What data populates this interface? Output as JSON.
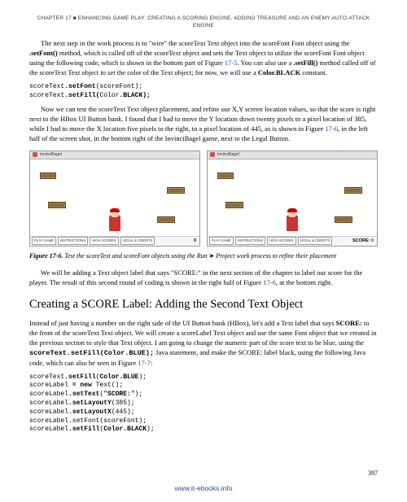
{
  "header": "CHAPTER 17 ■ ENHANCING GAME PLAY: CREATING A SCORING ENGINE, ADDING TREASURE AND AN ENEMY AUTO-ATTACK ENGINE",
  "para1_a": "The next step in the work process is to \"wire\" the scoreText Text object into the scoreFont Font object using the ",
  "para1_b": ".setFont()",
  "para1_c": " method, which is called off of the scoreText object and sets the Text object to utilize the scoreFont Font object using the following code, which is shown in the bottom part of Figure ",
  "para1_d": "17-5",
  "para1_e": ". You can also use a ",
  "para1_f": ".setFill()",
  "para1_g": " method called off of the scoreText Text object to set the color of the Text object; for now, we will use a ",
  "para1_h": "Color.BLACK",
  "para1_i": " constant.",
  "code1_l1": "scoreText",
  "code1_l1b": ".setFont",
  "code1_l1c": "(scoreFont);",
  "code1_l2": "scoreText",
  "code1_l2b": ".setFill(",
  "code1_l2c": "Color",
  "code1_l2d": ".BLACK);",
  "para2_a": "Now we can test the scoreText Text object placement, and refine our X,Y screen location values, so that the score is right next to the HBox UI Button bank. I found that I had to move the Y location down twenty pixels to a pixel location of 385, while I had to move the X location five pixels to the right, to a pixel location of 445, as is shown in Figure ",
  "para2_b": "17-6",
  "para2_c": ", in the left half of the screen shot, in the bottom right of the InvinciBagel game, next to the Legal Button.",
  "fig_title": "InvinciBagel",
  "btn1": "PLAY GAME",
  "btn2": "INSTRUCTIONS",
  "btn3": "HIGH SCORES",
  "btn4": "LEGAL & CREDITS",
  "score_label": "SCORE:",
  "score_val": "0",
  "legal_text": "",
  "caption_num": "Figure 17-6.",
  "caption_txt_a": "Test the scoreText and scoreFont objects using the Run ",
  "caption_txt_b": "➤",
  "caption_txt_c": " Project work process to refine their placement",
  "para3": "We will be adding a Text object label that says \"SCORE:\" in the next section of the chapter to label our score for the player. The result of this second round of coding is shown in the right half of Figure ",
  "para3_link": "17-6",
  "para3_end": ", at the bottom right.",
  "heading": "Creating a SCORE Label: Adding the Second Text Object",
  "para4_a": "Instead of just having a number on the right side of the UI Button bank (HBox), let's add a Text label that says ",
  "para4_b": "SCORE:",
  "para4_c": " to the front of the scoreText Text object. We will create a scoreLabel Text object and use the same Font object that we created in the previous section to style that Text object. I am going to change the numeric part of the score text to be blue, using the ",
  "para4_code": "scoreText.setFill(Color.BLUE);",
  "para4_d": " Java statement, and make the SCORE: label black, using the following Java code, which can also be seen in Figure ",
  "para4_link": "17-7",
  "para4_e": ":",
  "code2": {
    "l1a": "scoreText",
    "l1b": ".setFill",
    "l1c": "(",
    "l1d": "Color.BLUE",
    "l1e": ");",
    "l2a": "scoreLabel ",
    "l2b": "= new",
    "l2c": " Text();",
    "l3a": "scoreLabel",
    "l3b": ".setText",
    "l3c": "(\"",
    "l3d": "SCORE:",
    "l3e": "\");",
    "l4a": "scoreLabel",
    "l4b": ".setLayoutY",
    "l4c": "(385);",
    "l5a": "scoreLabel",
    "l5b": ".setLayoutX",
    "l5c": "(445);",
    "l6": "scoreLabel.setFont(scoreFont);",
    "l7a": "scoreLabel",
    "l7b": ".setFill",
    "l7c": "(",
    "l7d": "Color.BLACK",
    "l7e": ");"
  },
  "page_num": "397",
  "footer": "www.it-ebooks.info"
}
